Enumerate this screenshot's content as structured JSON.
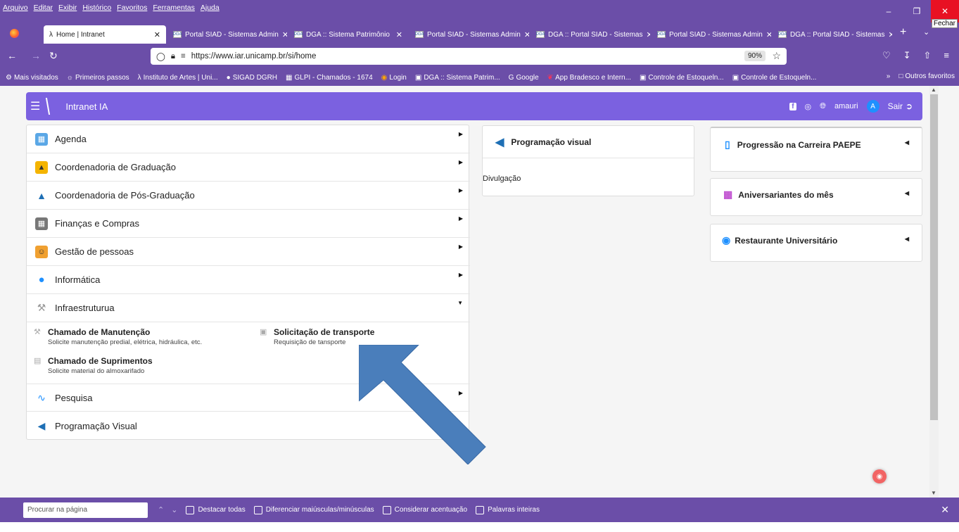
{
  "browser": {
    "menu": [
      "Arquivo",
      "Editar",
      "Exibir",
      "Histórico",
      "Favoritos",
      "Ferramentas",
      "Ajuda"
    ],
    "close_tooltip": "Fechar",
    "tabs": [
      {
        "label": "Home | Intranet",
        "active": true
      },
      {
        "label": "Portal SIAD - Sistemas Admin"
      },
      {
        "label": "DGA :: Sistema Patrimônio"
      },
      {
        "label": "Portal SIAD - Sistemas Admin"
      },
      {
        "label": "DGA :: Portal SIAD - Sistemas"
      },
      {
        "label": "Portal SIAD - Sistemas Admin"
      },
      {
        "label": "DGA :: Portal SIAD - Sistemas"
      }
    ],
    "url": "https://www.iar.unicamp.br/si/home",
    "zoom": "90%",
    "bookmarks": [
      "Mais visitados",
      "Primeiros passos",
      "Instituto de Artes | Uni...",
      "SIGAD DGRH",
      "GLPI - Chamados - 1674",
      "Login",
      "DGA :: Sistema Patrim...",
      "Google",
      "App Bradesco e Intern...",
      "Controle de Estoqueln...",
      "Controle de Estoqueln..."
    ],
    "other_bookmarks": "Outros favoritos"
  },
  "app": {
    "title": "Intranet IA",
    "user": "amauri",
    "avatar_letter": "A",
    "logout": "Sair",
    "accent": "#7b61e0"
  },
  "menu_items": [
    {
      "label": "Agenda",
      "icon": "calendar-icon"
    },
    {
      "label": "Coordenadoria de Graduação",
      "icon": "lock-icon"
    },
    {
      "label": "Coordenadoria de Pós-Graduação",
      "icon": "graduation-cap-icon"
    },
    {
      "label": "Finanças e Compras",
      "icon": "calculator-icon"
    },
    {
      "label": "Gestão de pessoas",
      "icon": "people-icon"
    },
    {
      "label": "Informática",
      "icon": "mouse-icon"
    },
    {
      "label": "Infraestruturua",
      "icon": "wrench-icon"
    },
    {
      "label": "Pesquisa",
      "icon": "research-icon"
    },
    {
      "label": "Programação Visual",
      "icon": "megaphone-icon"
    }
  ],
  "infra_sub": [
    {
      "title": "Chamado de Manutenção",
      "desc": "Solicite manutenção predial, elétrica, hidráulica, etc."
    },
    {
      "title": "Solicitação de transporte",
      "desc": "Requisição de tansporte"
    },
    {
      "title": "Chamado de Suprimentos",
      "desc": "Solicite material do almoxarifado"
    }
  ],
  "prog_card": {
    "title": "Programação visual",
    "link": "Divulgação"
  },
  "right_cards": [
    "Progressão na Carreira PAEPE",
    "Aniversariantes do mês",
    "Restaurante Universitário"
  ],
  "findbar": {
    "placeholder": "Procurar na página",
    "options": [
      "Destacar todas",
      "Diferenciar maiúsculas/minúsculas",
      "Considerar acentuação",
      "Palavras inteiras"
    ]
  }
}
